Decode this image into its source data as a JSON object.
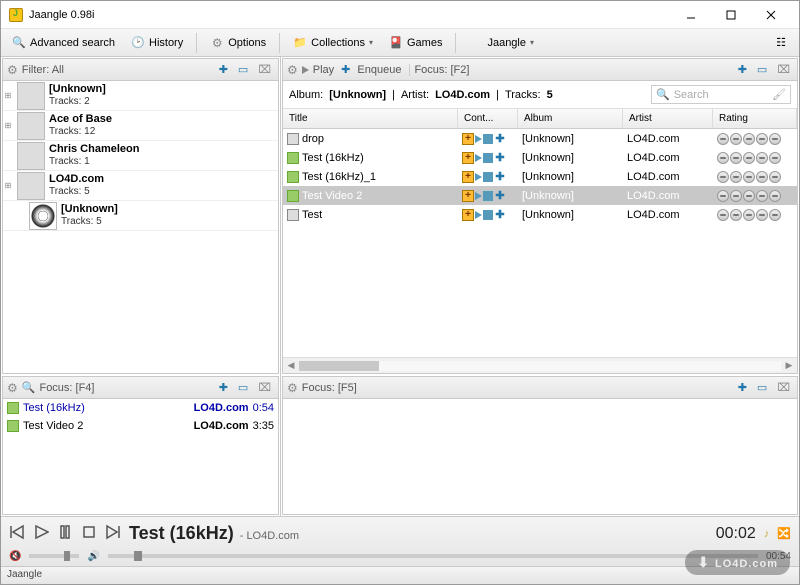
{
  "window": {
    "title": "Jaangle 0.98i"
  },
  "toolbar": {
    "adv_search": "Advanced search",
    "history": "History",
    "options": "Options",
    "collections": "Collections",
    "games": "Games",
    "jaangle": "Jaangle"
  },
  "filter_pane": {
    "header": "Filter: All",
    "items": [
      {
        "name": "[Unknown]",
        "tracks": "Tracks: 2",
        "expandable": true
      },
      {
        "name": "Ace of Base",
        "tracks": "Tracks: 12",
        "expandable": true
      },
      {
        "name": "Chris Chameleon",
        "tracks": "Tracks: 1",
        "expandable": false
      },
      {
        "name": "LO4D.com",
        "tracks": "Tracks: 5",
        "expandable": true
      },
      {
        "name": "[Unknown]",
        "tracks": "Tracks: 5",
        "expandable": false,
        "indent": true,
        "album": true
      }
    ]
  },
  "playlist_pane": {
    "header": "Focus: [F4]",
    "items": [
      {
        "name": "Test (16kHz)",
        "src": "LO4D.com",
        "time": "0:54",
        "active": true
      },
      {
        "name": "Test Video 2",
        "src": "LO4D.com",
        "time": "3:35",
        "active": false
      }
    ]
  },
  "tracks_pane": {
    "header_play": "Play",
    "header_enq": "Enqueue",
    "header_focus": "Focus: [F2]",
    "info": {
      "album_lbl": "Album:",
      "album": "[Unknown]",
      "artist_lbl": "Artist:",
      "artist": "LO4D.com",
      "tracks_lbl": "Tracks:",
      "tracks": "5",
      "search_ph": "Search"
    },
    "cols": {
      "title": "Title",
      "cont": "Cont...",
      "album": "Album",
      "artist": "Artist",
      "rating": "Rating"
    },
    "rows": [
      {
        "type": "video",
        "title": "drop",
        "album": "[Unknown]",
        "artist": "LO4D.com"
      },
      {
        "type": "audio",
        "title": "Test (16kHz)",
        "album": "[Unknown]",
        "artist": "LO4D.com"
      },
      {
        "type": "audio",
        "title": "Test (16kHz)_1",
        "album": "[Unknown]",
        "artist": "LO4D.com"
      },
      {
        "type": "audio",
        "title": "Test Video 2",
        "album": "[Unknown]",
        "artist": "LO4D.com",
        "selected": true
      },
      {
        "type": "video",
        "title": "Test",
        "album": "[Unknown]",
        "artist": "LO4D.com"
      }
    ]
  },
  "empty_pane": {
    "header": "Focus: [F5]"
  },
  "player": {
    "title": "Test (16kHz)",
    "sep": " - ",
    "artist": "LO4D.com",
    "elapsed": "00:02",
    "total": "00:54"
  },
  "status": "Jaangle",
  "watermark": "LO4D.com"
}
